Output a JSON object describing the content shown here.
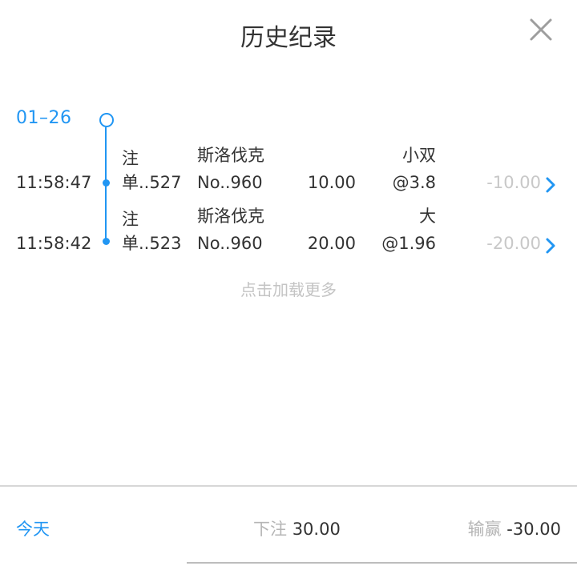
{
  "header": {
    "title": "历史纪录",
    "close_icon": "close-icon"
  },
  "timeline": {
    "date": "01–26",
    "accent_color": "#2196f3"
  },
  "records": [
    {
      "time": "11:58:47",
      "id_prefix": "注",
      "id_suffix": "单..527",
      "team": "斯洛伐克",
      "match_no": "No..960",
      "stake": "10.00",
      "pick": "小双",
      "odds": "@3.8",
      "result": "-10.00"
    },
    {
      "time": "11:58:42",
      "id_prefix": "注",
      "id_suffix": "单..523",
      "team": "斯洛伐克",
      "match_no": "No..960",
      "stake": "20.00",
      "pick": "大",
      "odds": "@1.96",
      "result": "-20.00"
    }
  ],
  "load_more": "点击加载更多",
  "footer": {
    "period": "今天",
    "bet_label": "下注",
    "bet_value": "30.00",
    "winloss_label": "输赢",
    "winloss_value": "-30.00"
  }
}
